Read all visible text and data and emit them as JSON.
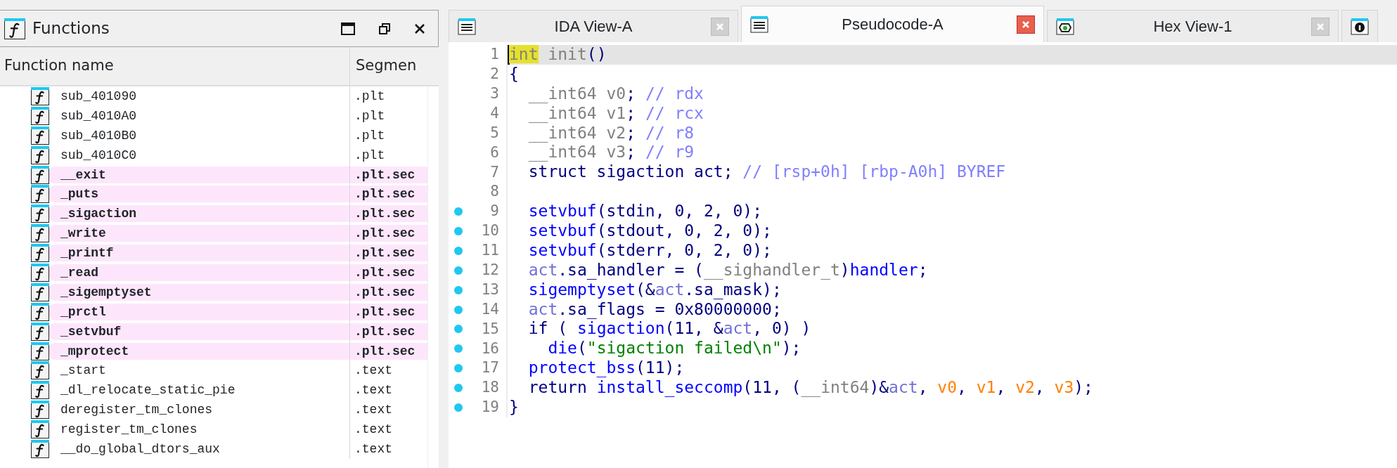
{
  "functions_panel": {
    "title": "Functions",
    "columns": [
      "Function name",
      "Segmen"
    ],
    "rows": [
      {
        "name": "sub_401090",
        "segment": ".plt",
        "highlighted": false
      },
      {
        "name": "sub_4010A0",
        "segment": ".plt",
        "highlighted": false
      },
      {
        "name": "sub_4010B0",
        "segment": ".plt",
        "highlighted": false
      },
      {
        "name": "sub_4010C0",
        "segment": ".plt",
        "highlighted": false
      },
      {
        "name": "__exit",
        "segment": ".plt.sec",
        "highlighted": true
      },
      {
        "name": "_puts",
        "segment": ".plt.sec",
        "highlighted": true
      },
      {
        "name": "_sigaction",
        "segment": ".plt.sec",
        "highlighted": true
      },
      {
        "name": "_write",
        "segment": ".plt.sec",
        "highlighted": true
      },
      {
        "name": "_printf",
        "segment": ".plt.sec",
        "highlighted": true
      },
      {
        "name": "_read",
        "segment": ".plt.sec",
        "highlighted": true
      },
      {
        "name": "_sigemptyset",
        "segment": ".plt.sec",
        "highlighted": true
      },
      {
        "name": "_prctl",
        "segment": ".plt.sec",
        "highlighted": true
      },
      {
        "name": "_setvbuf",
        "segment": ".plt.sec",
        "highlighted": true
      },
      {
        "name": "_mprotect",
        "segment": ".plt.sec",
        "highlighted": true
      },
      {
        "name": "_start",
        "segment": ".text",
        "highlighted": false
      },
      {
        "name": "_dl_relocate_static_pie",
        "segment": ".text",
        "highlighted": false
      },
      {
        "name": "deregister_tm_clones",
        "segment": ".text",
        "highlighted": false
      },
      {
        "name": "register_tm_clones",
        "segment": ".text",
        "highlighted": false
      },
      {
        "name": "__do_global_dtors_aux",
        "segment": ".text",
        "highlighted": false
      }
    ]
  },
  "tabs": [
    {
      "label": "IDA View-A",
      "kind": "listing",
      "selected": false
    },
    {
      "label": "Pseudocode-A",
      "kind": "listing",
      "selected": true
    },
    {
      "label": "Hex View-1",
      "kind": "hex",
      "selected": false
    },
    {
      "kind": "info",
      "selected": false
    }
  ],
  "code": [
    {
      "number": "1",
      "breakpoint": false,
      "current": true,
      "tokens": [
        {
          "kind": "hl",
          "text": "int"
        },
        {
          "kind": "kw",
          "text": " init"
        },
        {
          "kind": "p",
          "text": "()"
        }
      ]
    },
    {
      "number": "2",
      "breakpoint": false,
      "current": false,
      "tokens": [
        {
          "kind": "p",
          "text": "{"
        }
      ]
    },
    {
      "number": "3",
      "breakpoint": false,
      "current": false,
      "tokens": [
        {
          "kind": "kw",
          "text": "  __int64 v0"
        },
        {
          "kind": "p",
          "text": "; "
        },
        {
          "kind": "cm",
          "text": "// rdx"
        }
      ]
    },
    {
      "number": "4",
      "breakpoint": false,
      "current": false,
      "tokens": [
        {
          "kind": "kw",
          "text": "  __int64 v1"
        },
        {
          "kind": "p",
          "text": "; "
        },
        {
          "kind": "cm",
          "text": "// rcx"
        }
      ]
    },
    {
      "number": "5",
      "breakpoint": false,
      "current": false,
      "tokens": [
        {
          "kind": "kw",
          "text": "  __int64 v2"
        },
        {
          "kind": "p",
          "text": "; "
        },
        {
          "kind": "cm",
          "text": "// r8"
        }
      ]
    },
    {
      "number": "6",
      "breakpoint": false,
      "current": false,
      "tokens": [
        {
          "kind": "kw",
          "text": "  __int64 v3"
        },
        {
          "kind": "p",
          "text": "; "
        },
        {
          "kind": "cm",
          "text": "// r9"
        }
      ]
    },
    {
      "number": "7",
      "breakpoint": false,
      "current": false,
      "tokens": [
        {
          "kind": "p",
          "text": "  struct sigaction act; "
        },
        {
          "kind": "cm",
          "text": "// [rsp+0h] [rbp-A0h] BYREF"
        }
      ]
    },
    {
      "number": "8",
      "breakpoint": false,
      "current": false
    },
    {
      "number": "9",
      "breakpoint": true,
      "current": false,
      "tokens": [
        {
          "kind": "fn",
          "text": "  setvbuf"
        },
        {
          "kind": "p",
          "text": "(stdin, 0, 2, 0);"
        }
      ]
    },
    {
      "number": "10",
      "breakpoint": true,
      "current": false,
      "tokens": [
        {
          "kind": "fn",
          "text": "  setvbuf"
        },
        {
          "kind": "p",
          "text": "(stdout, 0, 2, 0);"
        }
      ]
    },
    {
      "number": "11",
      "breakpoint": true,
      "current": false,
      "tokens": [
        {
          "kind": "fn",
          "text": "  setvbuf"
        },
        {
          "kind": "p",
          "text": "(stderr, 0, 2, 0);"
        }
      ]
    },
    {
      "number": "12",
      "breakpoint": true,
      "current": false,
      "tokens": [
        {
          "kind": "var",
          "text": "  act"
        },
        {
          "kind": "p",
          "text": ".sa_handler = ("
        },
        {
          "kind": "kw",
          "text": "__sighandler_t"
        },
        {
          "kind": "p",
          "text": ")"
        },
        {
          "kind": "fn",
          "text": "handler"
        },
        {
          "kind": "p",
          "text": ";"
        }
      ]
    },
    {
      "number": "13",
      "breakpoint": true,
      "current": false,
      "tokens": [
        {
          "kind": "fn",
          "text": "  sigemptyset"
        },
        {
          "kind": "p",
          "text": "(&"
        },
        {
          "kind": "var",
          "text": "act"
        },
        {
          "kind": "p",
          "text": ".sa_mask);"
        }
      ]
    },
    {
      "number": "14",
      "breakpoint": true,
      "current": false,
      "tokens": [
        {
          "kind": "var",
          "text": "  act"
        },
        {
          "kind": "p",
          "text": ".sa_flags = 0x80000000;"
        }
      ]
    },
    {
      "number": "15",
      "breakpoint": true,
      "current": false,
      "tokens": [
        {
          "kind": "p",
          "text": "  if ( "
        },
        {
          "kind": "fn",
          "text": "sigaction"
        },
        {
          "kind": "p",
          "text": "(11, &"
        },
        {
          "kind": "var",
          "text": "act"
        },
        {
          "kind": "p",
          "text": ", 0) )"
        }
      ]
    },
    {
      "number": "16",
      "breakpoint": true,
      "current": false,
      "tokens": [
        {
          "kind": "fn",
          "text": "    die"
        },
        {
          "kind": "p",
          "text": "("
        },
        {
          "kind": "str",
          "text": "\"sigaction failed\\n\""
        },
        {
          "kind": "p",
          "text": ");"
        }
      ]
    },
    {
      "number": "17",
      "breakpoint": true,
      "current": false,
      "tokens": [
        {
          "kind": "fn",
          "text": "  protect_bss"
        },
        {
          "kind": "p",
          "text": "(11);"
        }
      ]
    },
    {
      "number": "18",
      "breakpoint": true,
      "current": false,
      "tokens": [
        {
          "kind": "p",
          "text": "  return "
        },
        {
          "kind": "fn",
          "text": "install_seccomp"
        },
        {
          "kind": "p",
          "text": "(11, ("
        },
        {
          "kind": "kw",
          "text": "__int64"
        },
        {
          "kind": "p",
          "text": ")&"
        },
        {
          "kind": "var",
          "text": "act"
        },
        {
          "kind": "p",
          "text": ", "
        },
        {
          "kind": "reg",
          "text": "v0"
        },
        {
          "kind": "p",
          "text": ", "
        },
        {
          "kind": "reg",
          "text": "v1"
        },
        {
          "kind": "p",
          "text": ", "
        },
        {
          "kind": "reg",
          "text": "v2"
        },
        {
          "kind": "p",
          "text": ", "
        },
        {
          "kind": "reg",
          "text": "v3"
        },
        {
          "kind": "p",
          "text": ");"
        }
      ]
    },
    {
      "number": "19",
      "breakpoint": true,
      "current": false,
      "tokens": [
        {
          "kind": "p",
          "text": "}"
        }
      ]
    }
  ]
}
